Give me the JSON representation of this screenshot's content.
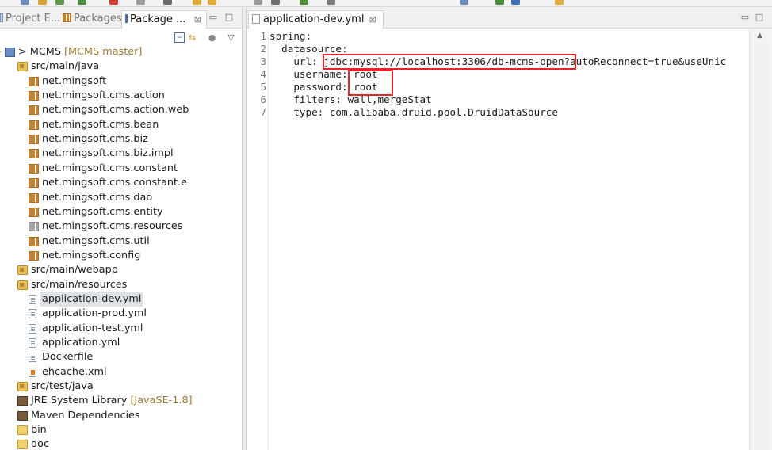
{
  "left_panel": {
    "tabs": [
      {
        "label": "Project E...",
        "icon": "project-explorer-icon",
        "active": false
      },
      {
        "label": "Packages",
        "icon": "packages-icon",
        "active": false
      },
      {
        "label": "Package ...",
        "icon": "package-explorer-icon",
        "active": true
      }
    ],
    "close_glyph": "⊠",
    "minimize_glyph": "▭",
    "maximize_glyph": "□",
    "view_menu_glyph": "▽",
    "tree": [
      {
        "label": "MCMS",
        "decoration": "[MCMS master]",
        "prefix": ">",
        "icon": "project-icon",
        "level": 0,
        "twisty": "▸"
      },
      {
        "label": "src/main/java",
        "icon": "source-folder-icon",
        "level": 1,
        "twisty": "⌄"
      },
      {
        "label": "net.mingsoft",
        "icon": "package-icon",
        "level": 2,
        "twisty": "›"
      },
      {
        "label": "net.mingsoft.cms.action",
        "icon": "package-icon",
        "level": 2,
        "twisty": "›"
      },
      {
        "label": "net.mingsoft.cms.action.web",
        "icon": "package-icon",
        "level": 2,
        "twisty": "›"
      },
      {
        "label": "net.mingsoft.cms.bean",
        "icon": "package-icon",
        "level": 2,
        "twisty": "›"
      },
      {
        "label": "net.mingsoft.cms.biz",
        "icon": "package-icon",
        "level": 2,
        "twisty": "›"
      },
      {
        "label": "net.mingsoft.cms.biz.impl",
        "icon": "package-icon",
        "level": 2,
        "twisty": "›"
      },
      {
        "label": "net.mingsoft.cms.constant",
        "icon": "package-icon",
        "level": 2,
        "twisty": "›"
      },
      {
        "label": "net.mingsoft.cms.constant.e",
        "icon": "package-icon",
        "level": 2,
        "twisty": "›"
      },
      {
        "label": "net.mingsoft.cms.dao",
        "icon": "package-icon",
        "level": 2,
        "twisty": "›"
      },
      {
        "label": "net.mingsoft.cms.entity",
        "icon": "package-icon",
        "level": 2,
        "twisty": "›"
      },
      {
        "label": "net.mingsoft.cms.resources",
        "icon": "empty-package-icon",
        "level": 2,
        "twisty": "›"
      },
      {
        "label": "net.mingsoft.cms.util",
        "icon": "package-icon",
        "level": 2,
        "twisty": "›"
      },
      {
        "label": "net.mingsoft.config",
        "icon": "package-icon",
        "level": 2,
        "twisty": "›"
      },
      {
        "label": "src/main/webapp",
        "icon": "source-folder-icon",
        "level": 1,
        "twisty": "›"
      },
      {
        "label": "src/main/resources",
        "icon": "source-folder-icon",
        "level": 1,
        "twisty": "⌄"
      },
      {
        "label": "application-dev.yml",
        "icon": "yml-file-icon",
        "level": 2,
        "twisty": "",
        "selected": true
      },
      {
        "label": "application-prod.yml",
        "icon": "yml-file-icon",
        "level": 2,
        "twisty": ""
      },
      {
        "label": "application-test.yml",
        "icon": "yml-file-icon",
        "level": 2,
        "twisty": ""
      },
      {
        "label": "application.yml",
        "icon": "yml-file-icon",
        "level": 2,
        "twisty": ""
      },
      {
        "label": "Dockerfile",
        "icon": "file-icon",
        "level": 2,
        "twisty": ""
      },
      {
        "label": "ehcache.xml",
        "icon": "xml-file-icon",
        "level": 2,
        "twisty": ""
      },
      {
        "label": "src/test/java",
        "icon": "source-folder-icon",
        "level": 1,
        "twisty": "›"
      },
      {
        "label": "JRE System Library",
        "decoration": "[JavaSE-1.8]",
        "icon": "library-icon",
        "level": 1,
        "twisty": "›"
      },
      {
        "label": "Maven Dependencies",
        "icon": "library-icon",
        "level": 1,
        "twisty": "›"
      },
      {
        "label": "bin",
        "icon": "folder-icon",
        "level": 1,
        "twisty": "›"
      },
      {
        "label": "doc",
        "icon": "folder-icon",
        "level": 1,
        "twisty": "›"
      }
    ]
  },
  "editor": {
    "tab_label": "application-dev.yml",
    "tab_close": "⊠",
    "lines": [
      {
        "n": "1",
        "text": "spring:"
      },
      {
        "n": "2",
        "text": "  datasource:"
      },
      {
        "n": "3",
        "text": "    url: jdbc:mysql://localhost:3306/db-mcms-open?autoReconnect=true&useUnic"
      },
      {
        "n": "4",
        "text": "    username: root"
      },
      {
        "n": "5",
        "text": "    password: root"
      },
      {
        "n": "6",
        "text": "    filters: wall,mergeStat"
      },
      {
        "n": "7",
        "text": "    type: com.alibaba.druid.pool.DruidDataSource"
      }
    ],
    "highlight_color": "#e3262b"
  }
}
